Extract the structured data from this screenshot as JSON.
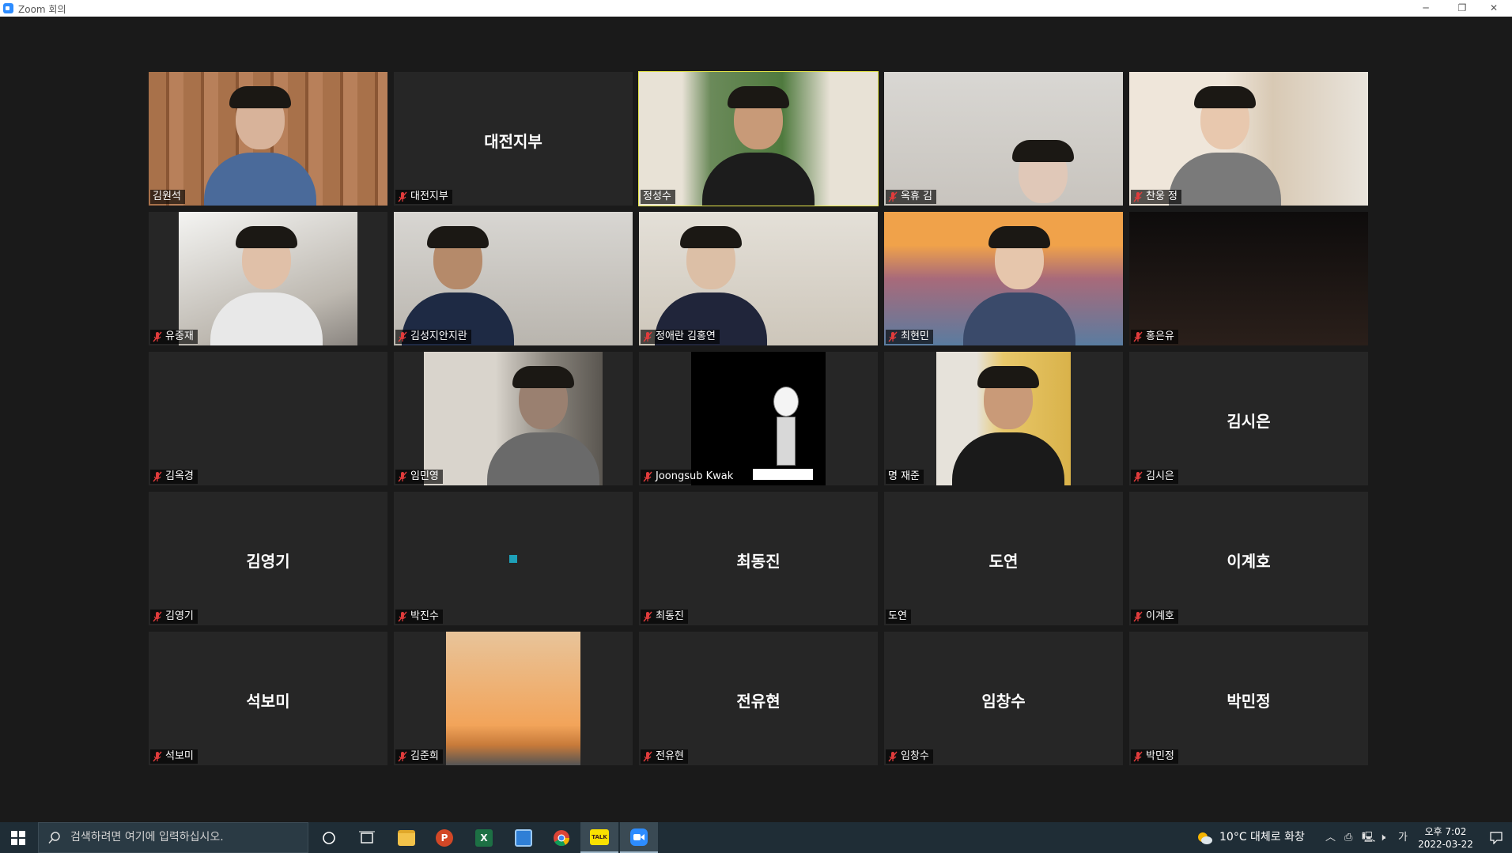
{
  "window": {
    "title": "Zoom 회의",
    "minimize_glyph": "─",
    "restore_glyph": "❐",
    "close_glyph": "✕"
  },
  "tiles": [
    {
      "label": "김원석",
      "muted": false,
      "center": "",
      "video": "wood-wall-man"
    },
    {
      "label": "대전지부",
      "muted": true,
      "center": "대전지부",
      "video": ""
    },
    {
      "label": "정성수",
      "muted": false,
      "center": "",
      "video": "bookshelf-man",
      "speaking": true
    },
    {
      "label": "옥휴 김",
      "muted": true,
      "center": "",
      "video": "blurred-woman"
    },
    {
      "label": "찬웅 정",
      "muted": true,
      "center": "",
      "video": "masked-man"
    },
    {
      "label": "유중재",
      "muted": true,
      "center": "",
      "video": "young-man-glasses"
    },
    {
      "label": "김성지안지란",
      "muted": true,
      "center": "",
      "video": "older-man-closet"
    },
    {
      "label": "정애란 김홍연",
      "muted": true,
      "center": "",
      "video": "hands-clasped"
    },
    {
      "label": "최현민",
      "muted": true,
      "center": "",
      "video": "golden-gate-boy"
    },
    {
      "label": "홍은유",
      "muted": true,
      "center": "",
      "video": "dark-room"
    },
    {
      "label": "김옥경",
      "muted": true,
      "center": "",
      "video": ""
    },
    {
      "label": "임민영",
      "muted": true,
      "center": "",
      "video": "dim-room-person"
    },
    {
      "label": "Joongsub Kwak",
      "muted": true,
      "center": "",
      "video": "caricature"
    },
    {
      "label": "명 재준",
      "muted": false,
      "center": "",
      "video": "yellow-room-man"
    },
    {
      "label": "김시은",
      "muted": true,
      "center": "김시은",
      "video": ""
    },
    {
      "label": "김영기",
      "muted": true,
      "center": "김영기",
      "video": ""
    },
    {
      "label": "박진수",
      "muted": true,
      "center": "",
      "video": "share-dot"
    },
    {
      "label": "최동진",
      "muted": true,
      "center": "최동진",
      "video": ""
    },
    {
      "label": "도연",
      "muted": false,
      "center": "도연",
      "video": ""
    },
    {
      "label": "이계호",
      "muted": true,
      "center": "이계호",
      "video": ""
    },
    {
      "label": "석보미",
      "muted": true,
      "center": "석보미",
      "video": ""
    },
    {
      "label": "김준희",
      "muted": true,
      "center": "",
      "video": "sunset-city"
    },
    {
      "label": "전유현",
      "muted": true,
      "center": "전유현",
      "video": ""
    },
    {
      "label": "임창수",
      "muted": true,
      "center": "임창수",
      "video": ""
    },
    {
      "label": "박민정",
      "muted": true,
      "center": "박민정",
      "video": ""
    }
  ],
  "taskbar": {
    "search_placeholder": "검색하려면 여기에 입력하십시오.",
    "pinned": [
      {
        "name": "cortana",
        "glyph": "○"
      },
      {
        "name": "task-view",
        "glyph": "⧉"
      },
      {
        "name": "file-explorer",
        "glyph": ""
      },
      {
        "name": "powerpoint",
        "glyph": "P"
      },
      {
        "name": "excel",
        "glyph": "X"
      },
      {
        "name": "calculator",
        "glyph": ""
      },
      {
        "name": "chrome",
        "glyph": ""
      },
      {
        "name": "kakaotalk",
        "glyph": "TALK"
      },
      {
        "name": "zoom",
        "glyph": ""
      }
    ],
    "weather": "10°C  대체로 화창",
    "ime_label": "가",
    "clock_time": "오후 7:02",
    "clock_date": "2022-03-22"
  },
  "colors": {
    "speaker_outline": "#e6e64a",
    "mute_red": "#e03c3c",
    "taskbar_bg": "#1f2d36",
    "tile_bg": "#262626"
  }
}
